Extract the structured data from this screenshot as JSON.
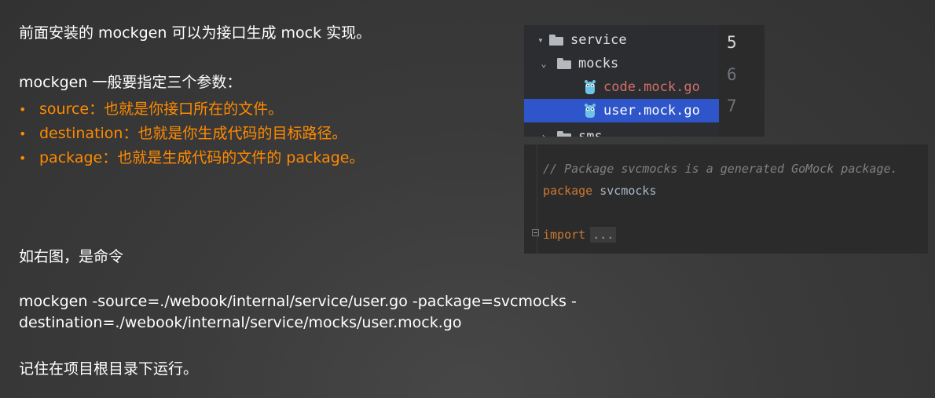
{
  "slide": {
    "intro": "前面安装的 mockgen 可以为接口生成 mock 实现。",
    "params_title": "mockgen 一般要指定三个参数：",
    "bullet_glyph": "•",
    "bullets": [
      "source：也就是你接口所在的文件。",
      "destination：也就是你生成代码的目标路径。",
      "package：也就是生成代码的文件的 package。"
    ],
    "figure_ref": "如右图，是命令",
    "command_line1": "mockgen -source=./webook/internal/service/user.go -package=svcmocks -",
    "command_line2": "destination=./webook/internal/service/mocks/user.mock.go",
    "footer": "记住在项目根目录下运行。",
    "accent_color": "#ff8a00"
  },
  "file_tree": {
    "items": [
      {
        "label": "service",
        "type": "folder",
        "expanded": true,
        "icon": "folder-icon"
      },
      {
        "label": "mocks",
        "type": "folder",
        "expanded": true,
        "icon": "folder-icon"
      },
      {
        "label": "code.mock.go",
        "type": "file",
        "icon": "go-gopher-icon",
        "color": "#d4706a"
      },
      {
        "label": "user.mock.go",
        "type": "file",
        "icon": "go-gopher-icon",
        "selected": true
      },
      {
        "label": "sms",
        "type": "folder",
        "expanded": false,
        "icon": "folder-icon"
      }
    ],
    "line_numbers": [
      "5",
      "6",
      "7"
    ],
    "selected_color": "#2e55ca"
  },
  "code": {
    "comment": "// Package svcmocks is a generated GoMock package.",
    "package_keyword": "package",
    "package_name": "svcmocks",
    "import_keyword": "import",
    "import_folded": "...",
    "keyword_color": "#cc7832",
    "comment_color": "#808080"
  }
}
